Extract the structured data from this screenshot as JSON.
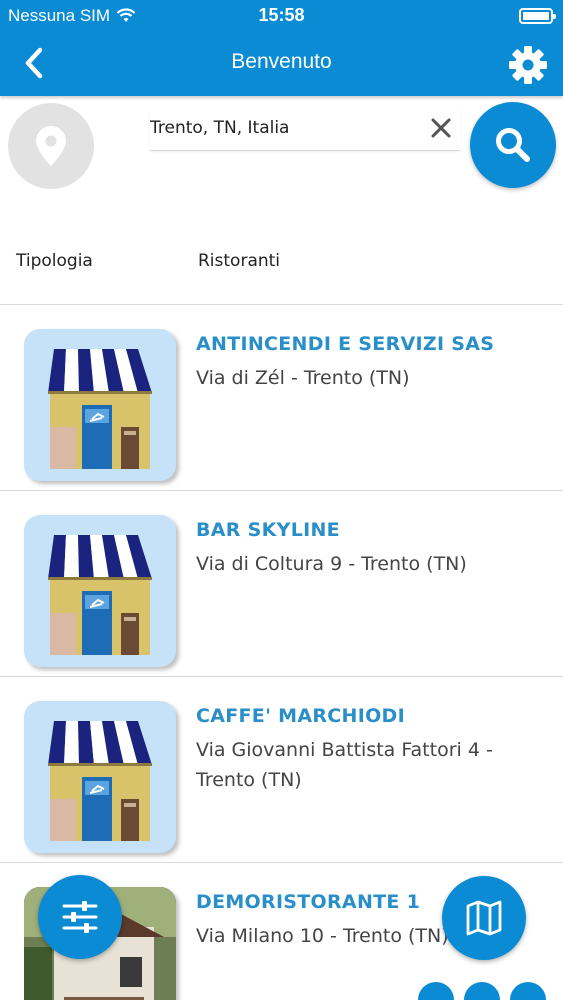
{
  "status_bar": {
    "carrier": "Nessuna SIM",
    "time": "15:58"
  },
  "nav": {
    "title": "Benvenuto"
  },
  "search": {
    "value": "Trento, TN, Italia"
  },
  "filter": {
    "label": "Tipologia",
    "value": "Ristoranti"
  },
  "items": [
    {
      "name": "ANTINCENDI E SERVIZI SAS",
      "address": "Via di Zél - Trento (TN)"
    },
    {
      "name": "BAR SKYLINE",
      "address": "Via di Coltura 9 - Trento (TN)"
    },
    {
      "name": "CAFFE' MARCHIODI",
      "address": "Via Giovanni Battista Fattori 4 - Trento (TN)"
    },
    {
      "name": "DEMORISTORANTE 1",
      "address": "Via Milano 10 - Trento (TN)"
    }
  ],
  "colors": {
    "primary": "#0a8bd3",
    "title_text": "#2a8fc8",
    "thumb_bg": "#c6e2f8"
  },
  "icons": {
    "back": "chevron-left-icon",
    "settings": "gear-icon",
    "location": "location-pin-icon",
    "clear": "close-icon",
    "search": "search-icon",
    "filter": "sliders-icon",
    "map": "map-icon"
  }
}
